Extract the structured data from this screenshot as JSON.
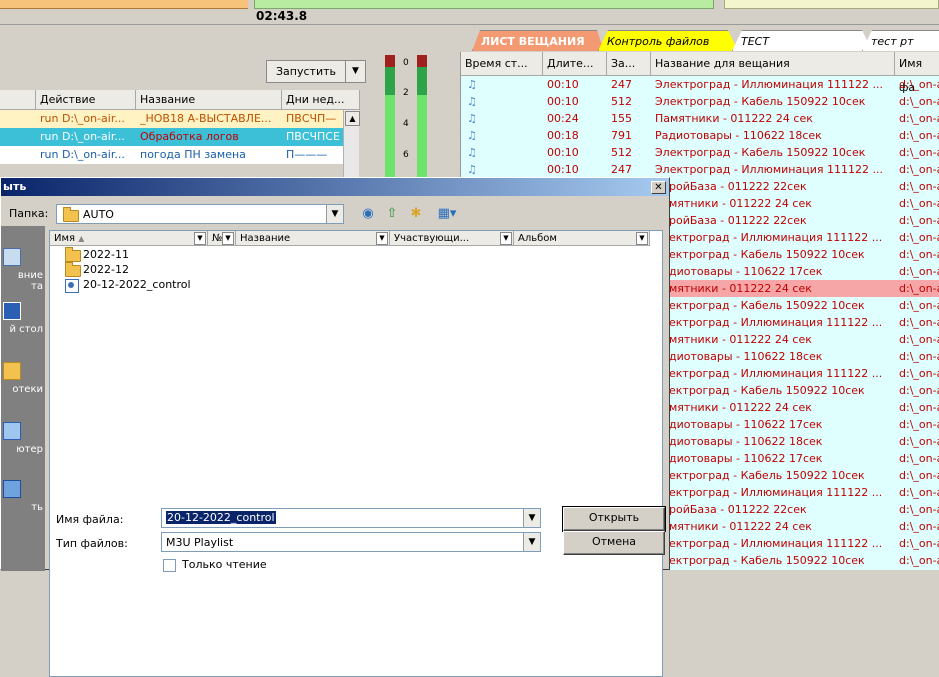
{
  "top": {
    "time": "02:43.8"
  },
  "left_panel": {
    "run_button": "Запустить",
    "columns": [
      "Действие",
      "Название",
      "Дни нед..."
    ],
    "rows": [
      {
        "action": "run D:\\_on-air...",
        "name": "_НОВ18 А-ВЫСТАВЛЕ...",
        "days": "ПВСЧП—"
      },
      {
        "action": "run D:\\_on-air...",
        "name": "Обработка логов",
        "days": "ПВСЧПСЕ"
      },
      {
        "action": "run D:\\_on-air...",
        "name": "погода ПН замена",
        "days": "П———"
      }
    ]
  },
  "vu_meter": {
    "labels": [
      "0",
      "2",
      "4",
      "6"
    ]
  },
  "broadcast": {
    "tabs": [
      "ЛИСТ ВЕЩАНИЯ",
      "Контроль файлов",
      "ТЕСТ",
      "тест рт"
    ],
    "columns": [
      "Время ст...",
      "Длите...",
      "За...",
      "Название для вещания",
      "Имя фа"
    ],
    "rows": [
      {
        "dur": "00:10",
        "num": "247",
        "name": "Электроград - Иллюминация 111122 ...",
        "file": "d:\\_on-a"
      },
      {
        "dur": "00:10",
        "num": "512",
        "name": "Электроград - Кабель 150922 10сек",
        "file": "d:\\_on-a"
      },
      {
        "dur": "00:24",
        "num": "155",
        "name": "Памятники - 011222 24 сек",
        "file": "d:\\_on-a"
      },
      {
        "dur": "00:18",
        "num": "791",
        "name": "Радиотовары - 110622 18сек",
        "file": "d:\\_on-a"
      },
      {
        "dur": "00:10",
        "num": "512",
        "name": "Электроград - Кабель 150922 10сек",
        "file": "d:\\_on-a"
      },
      {
        "dur": "00:10",
        "num": "247",
        "name": "Электроград - Иллюминация 111122 ...",
        "file": "d:\\_on-a"
      },
      {
        "dur": "",
        "num": "",
        "name": "ройБаза - 011222 22сек",
        "file": "d:\\_on-a"
      },
      {
        "dur": "",
        "num": "",
        "name": "мятники - 011222 24 сек",
        "file": "d:\\_on-a"
      },
      {
        "dur": "",
        "num": "",
        "name": "ройБаза - 011222 22сек",
        "file": "d:\\_on-a"
      },
      {
        "dur": "",
        "num": "",
        "name": "ектроград - Иллюминация 111122 ...",
        "file": "d:\\_on-a"
      },
      {
        "dur": "",
        "num": "",
        "name": "ектроград - Кабель 150922 10сек",
        "file": "d:\\_on-a"
      },
      {
        "dur": "",
        "num": "",
        "name": "диотовары - 110622 17сек",
        "file": "d:\\_on-a"
      },
      {
        "dur": "",
        "num": "",
        "name": "мятники - 011222 24 сек",
        "file": "d:\\_on-a",
        "highlight": true
      },
      {
        "dur": "",
        "num": "",
        "name": "ектроград - Кабель 150922 10сек",
        "file": "d:\\_on-a"
      },
      {
        "dur": "",
        "num": "",
        "name": "ектроград - Иллюминация 111122 ...",
        "file": "d:\\_on-a"
      },
      {
        "dur": "",
        "num": "",
        "name": "мятники - 011222 24 сек",
        "file": "d:\\_on-a"
      },
      {
        "dur": "",
        "num": "",
        "name": "диотовары - 110622 18сек",
        "file": "d:\\_on-a"
      },
      {
        "dur": "",
        "num": "",
        "name": "ектроград - Иллюминация 111122 ...",
        "file": "d:\\_on-a"
      },
      {
        "dur": "",
        "num": "",
        "name": "ектроград - Кабель 150922 10сек",
        "file": "d:\\_on-a"
      },
      {
        "dur": "",
        "num": "",
        "name": "мятники - 011222 24 сек",
        "file": "d:\\_on-a"
      },
      {
        "dur": "",
        "num": "",
        "name": "диотовары - 110622 17сек",
        "file": "d:\\_on-a"
      },
      {
        "dur": "",
        "num": "",
        "name": "диотовары - 110622 18сек",
        "file": "d:\\_on-a"
      },
      {
        "dur": "",
        "num": "",
        "name": "диотовары - 110622 17сек",
        "file": "d:\\_on-a"
      },
      {
        "dur": "",
        "num": "",
        "name": "ектроград - Кабель 150922 10сек",
        "file": "d:\\_on-a"
      },
      {
        "dur": "",
        "num": "",
        "name": "ектроград - Иллюминация 111122 ...",
        "file": "d:\\_on-a"
      },
      {
        "dur": "",
        "num": "",
        "name": "ройБаза - 011222 22сек",
        "file": "d:\\_on-a"
      },
      {
        "dur": "",
        "num": "",
        "name": "мятники - 011222 24 сек",
        "file": "d:\\_on-a"
      },
      {
        "dur": "",
        "num": "",
        "name": "ектроград - Иллюминация 111122 ...",
        "file": "d:\\_on-a"
      },
      {
        "dur": "",
        "num": "",
        "name": "ектроград - Кабель 150922 10сек",
        "file": "d:\\_on-a"
      }
    ],
    "colors": {
      "row_text": "#c00000",
      "note_icon": "#4b84c9",
      "row_bg": "#dfffff",
      "highlight_bg": "#f6a6a6"
    }
  },
  "dialog": {
    "title": "ыть",
    "folder_label": "Папка:",
    "folder_value": "AUTO",
    "columns": [
      "Имя",
      "№",
      "Название",
      "Участвующи...",
      "Альбом"
    ],
    "items": [
      {
        "type": "folder",
        "name": "2022-11"
      },
      {
        "type": "folder",
        "name": "2022-12"
      },
      {
        "type": "m3u",
        "name": "20-12-2022_control"
      }
    ],
    "places": [
      "вние\nта",
      "й стол",
      "отеки",
      "ютер",
      "ть"
    ],
    "filename_label": "Имя файла:",
    "filename_value": "20-12-2022_control",
    "filetype_label": "Тип файлов:",
    "filetype_value": "M3U Playlist",
    "open_button": "Открыть",
    "cancel_button": "Отмена",
    "readonly_label": "Только чтение"
  }
}
